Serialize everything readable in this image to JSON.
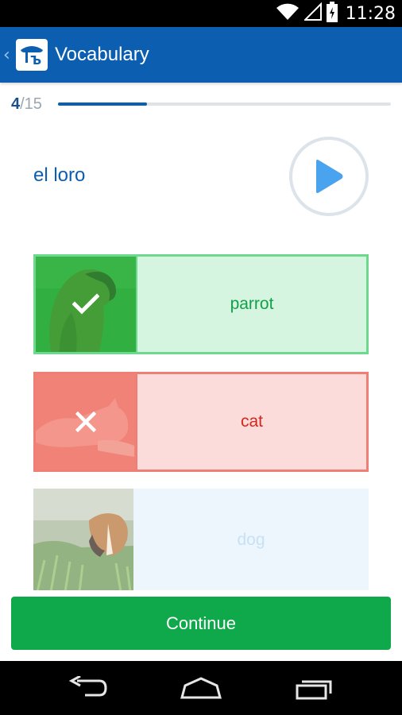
{
  "status_bar": {
    "time": "11:28",
    "icons": [
      "wifi-icon",
      "signal-icon",
      "battery-icon"
    ]
  },
  "app_bar": {
    "title": "Vocabulary",
    "icons": [
      "back-chevron-icon",
      "app-logo-icon"
    ]
  },
  "progress": {
    "current": "4",
    "total": "/15",
    "fraction": 0.267
  },
  "question": {
    "word": "el loro",
    "play_icon": "play-icon"
  },
  "options": [
    {
      "label": "parrot",
      "state": "correct",
      "status_icon": "checkmark-icon",
      "image": "parrot-image"
    },
    {
      "label": "cat",
      "state": "wrong",
      "status_icon": "cross-icon",
      "image": "cat-image"
    },
    {
      "label": "dog",
      "state": "neutral",
      "image": "dog-image"
    }
  ],
  "continue_button": {
    "label": "Continue"
  },
  "colors": {
    "app_bar": "#0b5eb0",
    "correct_border": "#6fd88f",
    "correct_bg": "#d5f5e0",
    "wrong_border": "#ee7f76",
    "wrong_bg": "#fbdcda",
    "continue_bg": "#0fa84a"
  },
  "nav_bar": {
    "icons": [
      "back-icon",
      "home-icon",
      "recents-icon"
    ]
  }
}
